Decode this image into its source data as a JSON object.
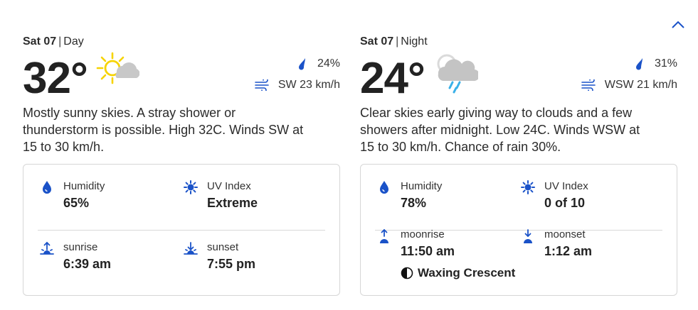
{
  "colors": {
    "accent": "#1a52c8",
    "sun": "#f6d300",
    "cloud": "#c4c4c4",
    "rain": "#39b0e8"
  },
  "day": {
    "date": "Sat 07",
    "period": "Day",
    "temp": "32°",
    "condition_icon": "mostly-sunny-icon",
    "precip": "24%",
    "wind": "SW 23 km/h",
    "description": "Mostly sunny skies. A stray shower or thunderstorm is possible. High 32C. Winds SW at 15 to 30 km/h.",
    "humidity_label": "Humidity",
    "humidity": "65%",
    "uv_label": "UV Index",
    "uv": "Extreme",
    "rise_label": "sunrise",
    "rise": "6:39 am",
    "set_label": "sunset",
    "set": "7:55 pm"
  },
  "night": {
    "date": "Sat 07",
    "period": "Night",
    "temp": "24°",
    "condition_icon": "cloud-rain-icon",
    "precip": "31%",
    "wind": "WSW 21 km/h",
    "description": "Clear skies early giving way to clouds and a few showers after midnight. Low 24C. Winds WSW at 15 to 30 km/h. Chance of rain 30%.",
    "humidity_label": "Humidity",
    "humidity": "78%",
    "uv_label": "UV Index",
    "uv": "0 of 10",
    "rise_label": "moonrise",
    "rise": "11:50 am",
    "set_label": "moonset",
    "set": "1:12 am",
    "moon_phase": "Waxing Crescent"
  }
}
